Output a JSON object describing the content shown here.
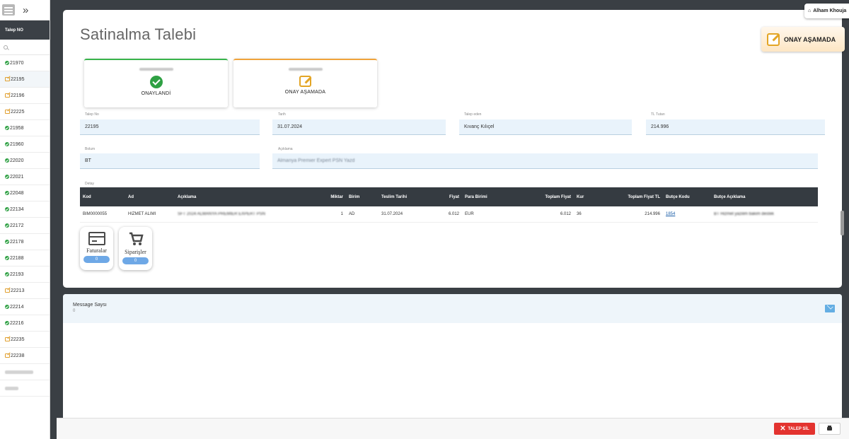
{
  "sidebar": {
    "header": "Talep NO",
    "items": [
      {
        "no": "21970",
        "status": "approved"
      },
      {
        "no": "22195",
        "status": "pending",
        "active": true
      },
      {
        "no": "22196",
        "status": "pending"
      },
      {
        "no": "22225",
        "status": "pending"
      },
      {
        "no": "21958",
        "status": "approved"
      },
      {
        "no": "21960",
        "status": "approved"
      },
      {
        "no": "22020",
        "status": "approved"
      },
      {
        "no": "22021",
        "status": "approved"
      },
      {
        "no": "22048",
        "status": "approved"
      },
      {
        "no": "22134",
        "status": "approved"
      },
      {
        "no": "22172",
        "status": "approved"
      },
      {
        "no": "22178",
        "status": "approved"
      },
      {
        "no": "22188",
        "status": "approved"
      },
      {
        "no": "22193",
        "status": "approved"
      },
      {
        "no": "22213",
        "status": "pending"
      },
      {
        "no": "22214",
        "status": "approved"
      },
      {
        "no": "22216",
        "status": "approved"
      },
      {
        "no": "22235",
        "status": "pending"
      },
      {
        "no": "22238",
        "status": "pending"
      }
    ]
  },
  "header": {
    "title": "Satinalma Talebi",
    "stage_label": "ONAY AŞAMADA",
    "user": "Alham Khouja"
  },
  "approvals": [
    {
      "status": "ONAYLANDİ",
      "state": "approved"
    },
    {
      "status": "ONAY AŞAMADA",
      "state": "pending"
    }
  ],
  "fields": {
    "talep_no": {
      "label": "Talep No",
      "value": "22195"
    },
    "tarih": {
      "label": "Tarih",
      "value": "31.07.2024"
    },
    "talep_eden": {
      "label": "Talep eden",
      "value": "Kıvanç Kılıçel"
    },
    "tl_tutari": {
      "label": "TL Tutarı",
      "value": "214.996"
    },
    "bolum": {
      "label": "Bolum",
      "value": "BT"
    },
    "aciklama": {
      "label": "Açıklama",
      "value": "Almanya Premier Expert PSN Yazd"
    }
  },
  "detail": {
    "label": "Detay",
    "columns": [
      "Kod",
      "Ad",
      "Açıklama",
      "Miktar",
      "Birim",
      "Teslim Tarihi",
      "Fiyat",
      "Para Birimi",
      "Toplam Fiyat",
      "Kur",
      "Toplam Fiyat TL",
      "Butçe Kodu",
      "Butçe Açıklama"
    ],
    "rows": [
      {
        "kod": "BIM0000055",
        "ad": "HIZMET ALIMI",
        "aciklama": "SFT 2024 ALMANYA PREMIER EXPERT PSN",
        "miktar": "1",
        "birim": "AD",
        "teslim": "31.07.2024",
        "fiyat": "6.012",
        "para": "EUR",
        "toplam": "6.012",
        "kur": "36",
        "toplam_tl": "214.996",
        "butce_kodu": "1854",
        "butce_aciklama": "BT Hizmet yazilim bakim destek"
      }
    ]
  },
  "documents": {
    "faturalar": {
      "label": "Faturalar",
      "count": "0"
    },
    "siparisler": {
      "label": "Siparişler",
      "count": "0"
    }
  },
  "messages": {
    "title": "Message Saysı",
    "count": "0"
  },
  "actions": {
    "delete_label": "TALEP SİL"
  },
  "colors": {
    "approved": "#2ea043",
    "pending": "#e0a030",
    "danger": "#e3332f",
    "header_dark": "#353b41",
    "field_bg": "#e9f3fb"
  }
}
